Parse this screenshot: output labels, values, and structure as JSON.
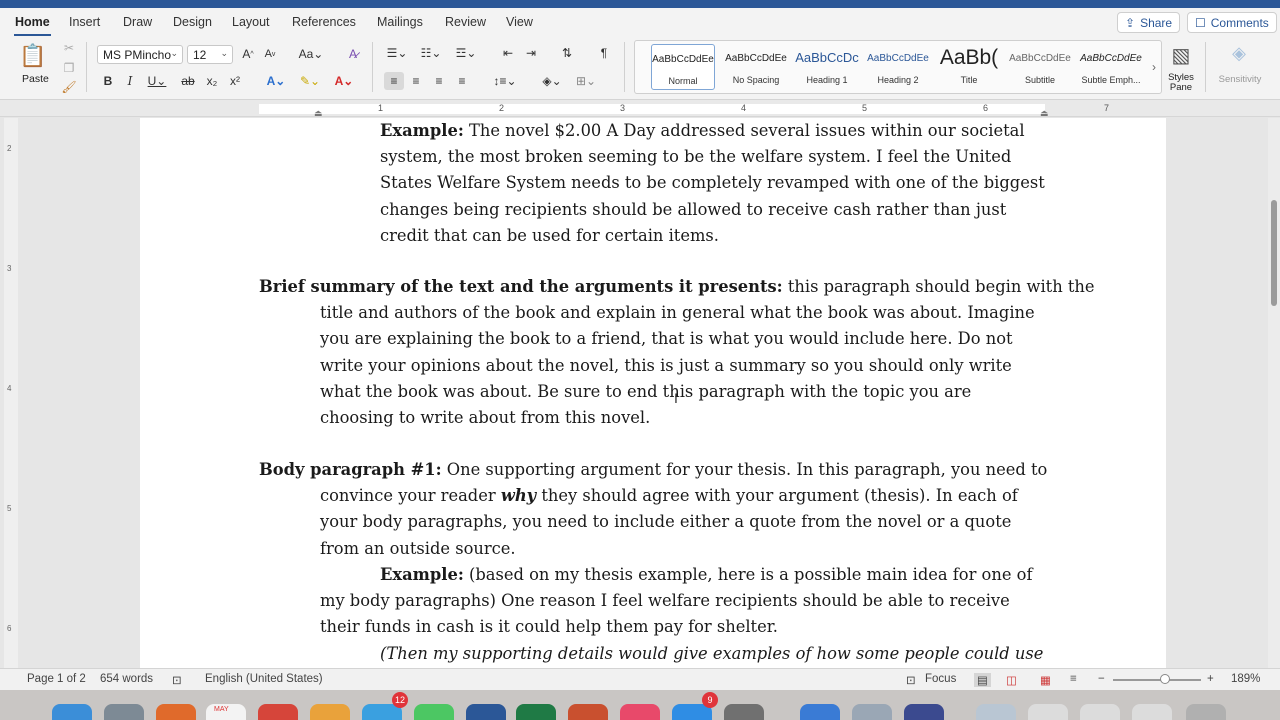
{
  "tabs": [
    "Home",
    "Insert",
    "Draw",
    "Design",
    "Layout",
    "References",
    "Mailings",
    "Review",
    "View"
  ],
  "share_label": "Share",
  "comments_label": "Comments",
  "ribbon": {
    "paste_label": "Paste",
    "font_name": "MS PMincho",
    "font_size": "12",
    "styles": [
      {
        "preview": "AaBbCcDdEe",
        "name": "Normal"
      },
      {
        "preview": "AaBbCcDdEe",
        "name": "No Spacing"
      },
      {
        "preview": "AaBbCcDc",
        "name": "Heading 1"
      },
      {
        "preview": "AaBbCcDdEe",
        "name": "Heading 2"
      },
      {
        "preview": "AaBb(",
        "name": "Title"
      },
      {
        "preview": "AaBbCcDdEe",
        "name": "Subtitle"
      },
      {
        "preview": "AaBbCcDdEe",
        "name": "Subtle Emph..."
      }
    ],
    "styles_pane_label": "Styles Pane",
    "sensitivity_label": "Sensitivity"
  },
  "ruler_numbers": [
    "1",
    "2",
    "3",
    "4",
    "5",
    "6",
    "7"
  ],
  "vruler_numbers": [
    "2",
    "3",
    "4",
    "5",
    "6"
  ],
  "document": {
    "p1": {
      "label": "Example:",
      "lines": [
        " The novel $2.00 A Day addressed several issues within our societal",
        "system, the most broken seeming to be the welfare system. I feel the United",
        "States Welfare System needs to be completely revamped with one of the biggest",
        "changes being recipients should be allowed to receive cash rather than just",
        "credit that can be used for certain items."
      ]
    },
    "p2": {
      "label": "Brief summary of the text and the arguments it presents:",
      "first_rest": " this paragraph should begin with the",
      "lines": [
        "title and authors of the book and explain in general what the book was about. Imagine",
        "you are explaining the book to a friend, that is what you would include here. Do not",
        "write your opinions about the novel, this is just a summary so you should only write",
        "what the book was about. Be sure to end this paragraph with the topic you are",
        "choosing to write about from this novel."
      ]
    },
    "p3": {
      "label": "Body paragraph #1:",
      "first_rest": " One supporting argument for your thesis. In this paragraph, you need to",
      "line2_pre": "convince your reader ",
      "line2_em": "why",
      "line2_post": " they should agree with your argument (thesis). In each of",
      "lines": [
        "your body paragraphs, you need to include either a quote from the novel or a quote",
        "from an outside source."
      ]
    },
    "p4": {
      "label": "Example:",
      "first_rest": " (based on my thesis example, here is a possible main idea for one of",
      "lines": [
        "my body paragraphs) One reason I feel welfare recipients should be able to receive",
        "their funds in cash is it could help them pay for shelter."
      ]
    },
    "p5": {
      "line": "(Then my supporting details would give examples of how some people could use"
    }
  },
  "status": {
    "page": "Page 1 of 2",
    "words": "654 words",
    "language": "English (United States)",
    "focus": "Focus",
    "zoom": "189%"
  },
  "dock_badges": [
    "MAY",
    "12",
    "9"
  ]
}
